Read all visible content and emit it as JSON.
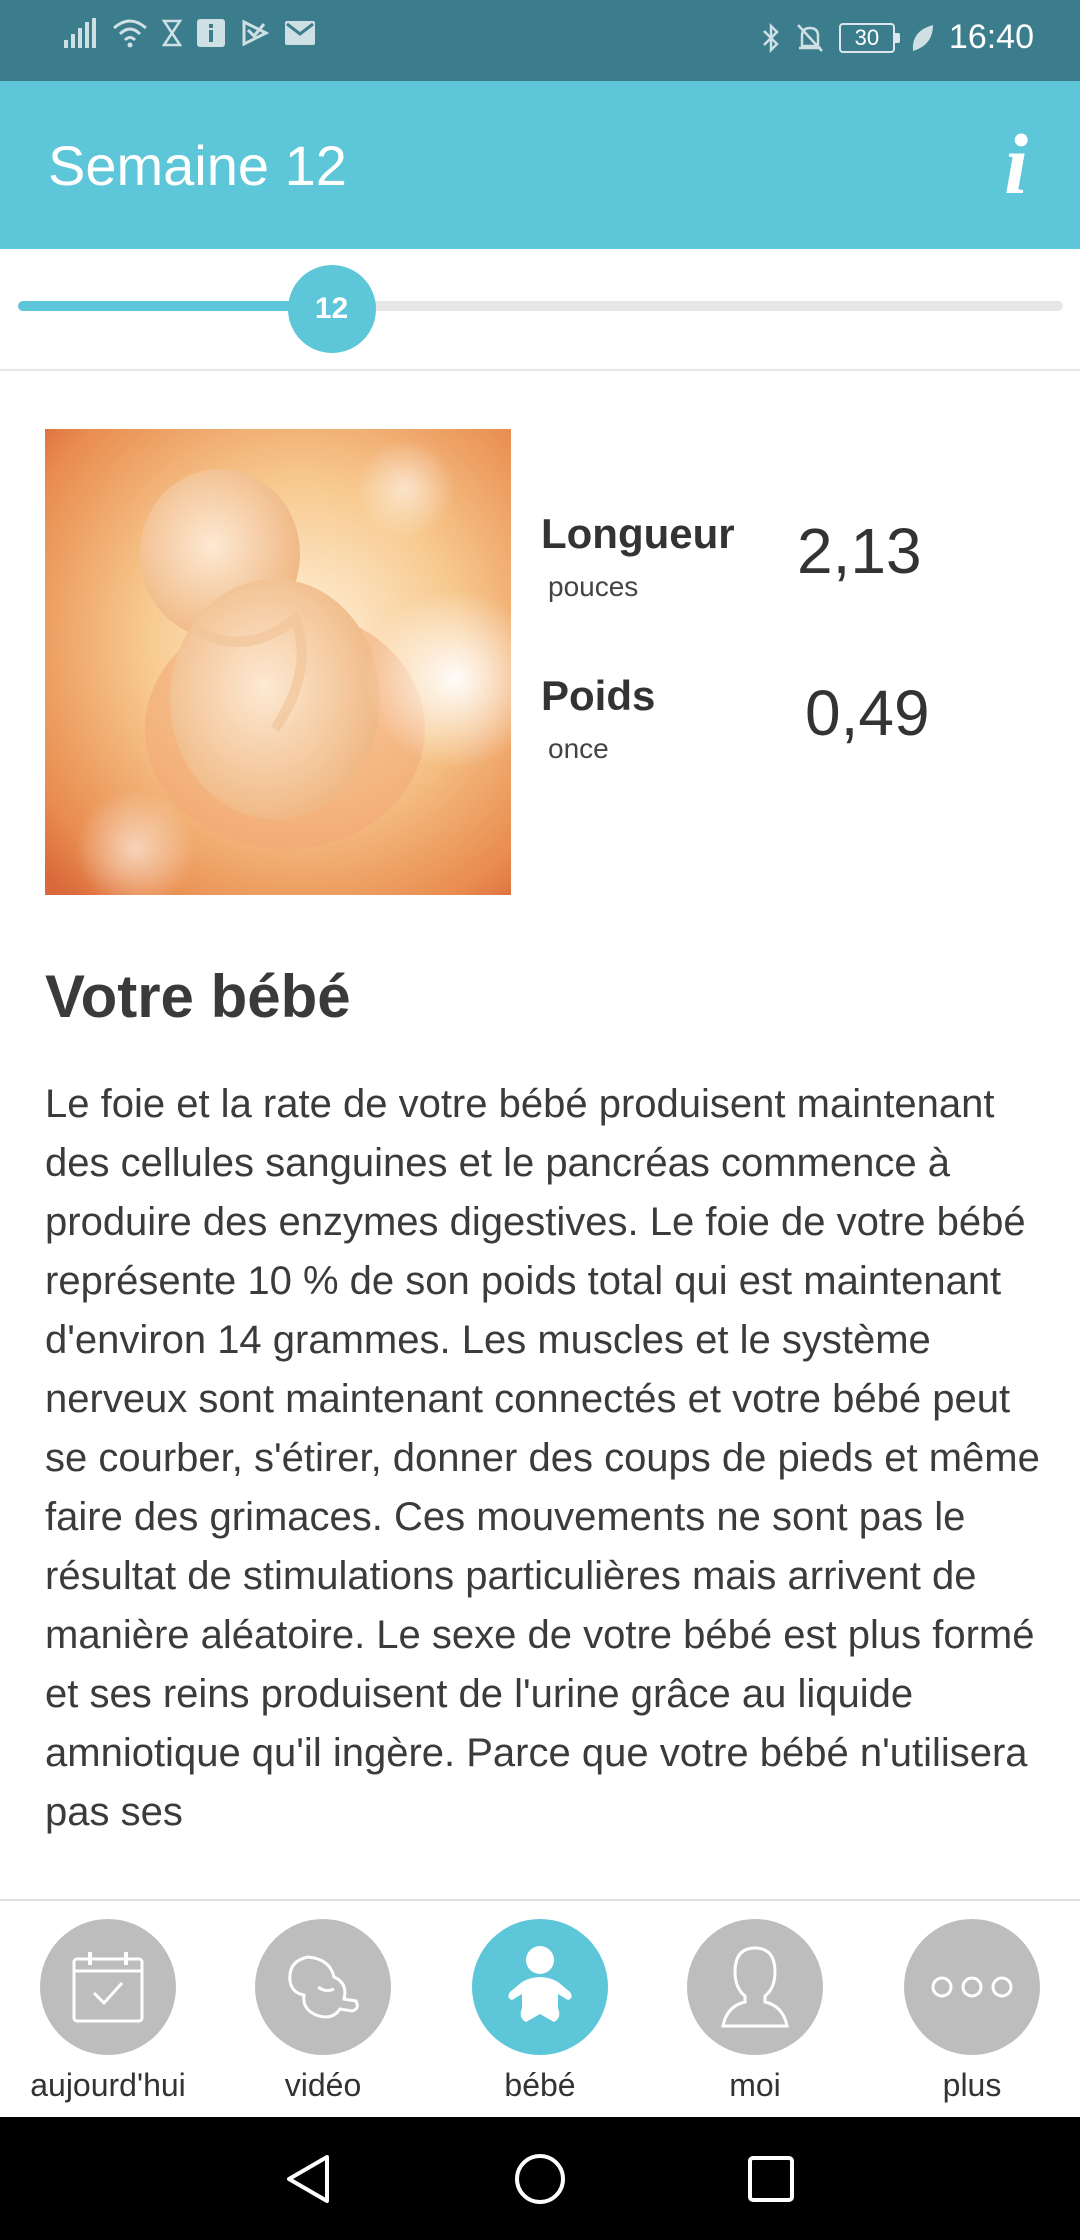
{
  "status_bar": {
    "time": "16:40",
    "battery": "30",
    "left_icons": [
      "signal-icon",
      "wifi-icon",
      "hourglass-icon",
      "info-notification-icon",
      "play-notification-icon",
      "mail-icon"
    ],
    "right_icons": [
      "bluetooth-icon",
      "bell-off-icon",
      "battery-icon",
      "leaf-icon"
    ]
  },
  "app_bar": {
    "title": "Semaine 12",
    "info_label": "i"
  },
  "week_slider": {
    "current_week": "12",
    "progress_fraction": 0.3
  },
  "baby_stats": {
    "length_label": "Longueur",
    "length_unit": "pouces",
    "length_value": "2,13",
    "weight_label": "Poids",
    "weight_unit": "once",
    "weight_value": "0,49"
  },
  "section": {
    "title": "Votre bébé",
    "body": "Le foie et la rate de votre bébé produisent maintenant des cellules sanguines et le pancréas commence à produire des enzymes digestives. Le foie de votre bébé représente 10 % de son poids total qui est maintenant d'environ 14 grammes. Les muscles et le système nerveux sont maintenant connectés et votre bébé peut se courber, s'étirer, donner des coups de pieds et même faire des grimaces. Ces mouvements ne sont pas le résultat de stimulations particulières mais arrivent de manière aléatoire. Le sexe de votre bébé est plus formé et ses reins produisent de l'urine grâce au liquide amniotique qu'il ingère. Parce que votre bébé  n'utilisera pas ses"
  },
  "bottom_nav": {
    "items": [
      {
        "label": "aujourd'hui",
        "icon": "calendar-check-icon"
      },
      {
        "label": "vidéo",
        "icon": "fetus-icon"
      },
      {
        "label": "bébé",
        "icon": "baby-icon",
        "active": true
      },
      {
        "label": "moi",
        "icon": "person-icon"
      },
      {
        "label": "plus",
        "icon": "more-dots-icon"
      }
    ]
  },
  "colors": {
    "status_bar": "#3b7d8c",
    "accent": "#5dc6d8",
    "inactive_nav": "#bdbdbd",
    "text": "#333333"
  }
}
